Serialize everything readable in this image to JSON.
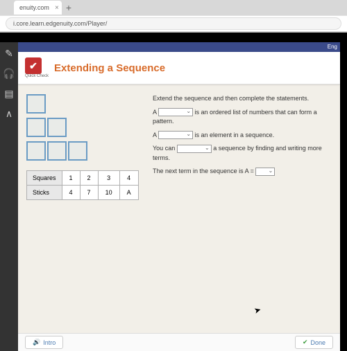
{
  "browser": {
    "tab_title": "enuity.com",
    "url": "i.core.learn.edgenuity.com/Player/"
  },
  "banner": {
    "right_text": "Eng"
  },
  "header": {
    "quiz_label": "Quick Check",
    "title": "Extending a Sequence"
  },
  "table": {
    "row1_label": "Squares",
    "row2_label": "Sticks",
    "cols": [
      "1",
      "2",
      "3",
      "4"
    ],
    "sticks": [
      "4",
      "7",
      "10",
      "A"
    ]
  },
  "instructions": {
    "intro": "Extend the sequence and then complete the statements.",
    "s1_a": "A ",
    "s1_b": " is an ordered list of numbers that can form a pattern.",
    "s2_a": "A ",
    "s2_b": " is an element in a sequence.",
    "s3_a": "You can ",
    "s3_b": " a sequence by finding and writing more terms.",
    "s4_a": "The next term in the sequence is A = "
  },
  "footer": {
    "intro_label": "Intro",
    "done_label": "Done"
  }
}
